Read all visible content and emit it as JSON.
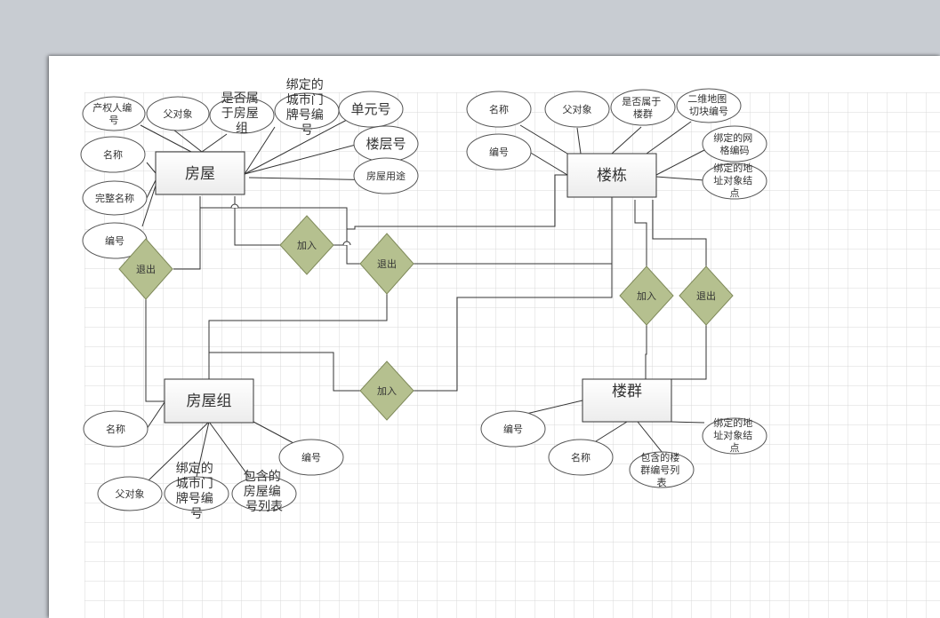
{
  "entities": {
    "house": "房屋",
    "building": "楼栋",
    "house_group": "房屋组",
    "building_group": "楼群"
  },
  "house_attrs": {
    "owner_id": [
      "产权人编",
      "号"
    ],
    "parent": "父对象",
    "in_group": [
      "是否属",
      "于房屋",
      "组"
    ],
    "doorplate": [
      "绑定的",
      "城市门",
      "牌号编",
      "号"
    ],
    "unit_no": "单元号",
    "name": "名称",
    "full_name": "完整名称",
    "floor_no": "楼层号",
    "usage": "房屋用途",
    "code": "编号"
  },
  "building_attrs": {
    "name": "名称",
    "parent": "父对象",
    "in_group": [
      "是否属于",
      "楼群"
    ],
    "map_tile": [
      "二维地图",
      "切块编号"
    ],
    "code": "编号",
    "grid_code": [
      "绑定的网",
      "格编码"
    ],
    "address_node": [
      "绑定的地",
      "址对象结",
      "点"
    ]
  },
  "group_attrs": {
    "name": "名称",
    "code": "编号",
    "parent": "父对象",
    "doorplate": [
      "绑定的",
      "城市门",
      "牌号编",
      "号"
    ],
    "house_list": [
      "包含的",
      "房屋编",
      "号列表"
    ]
  },
  "building_group_attrs": {
    "code": "编号",
    "name": "名称",
    "building_list": [
      "包含的楼",
      "群编号列",
      "表"
    ],
    "address_node": [
      "绑定的地",
      "址对象结",
      "点"
    ]
  },
  "relations": {
    "join": "加入",
    "quit": "退出"
  },
  "colors": {
    "diamond_fill": "#b5c08f",
    "diamond_stroke": "#7f8a5a",
    "grid": "#d9d9d9"
  }
}
